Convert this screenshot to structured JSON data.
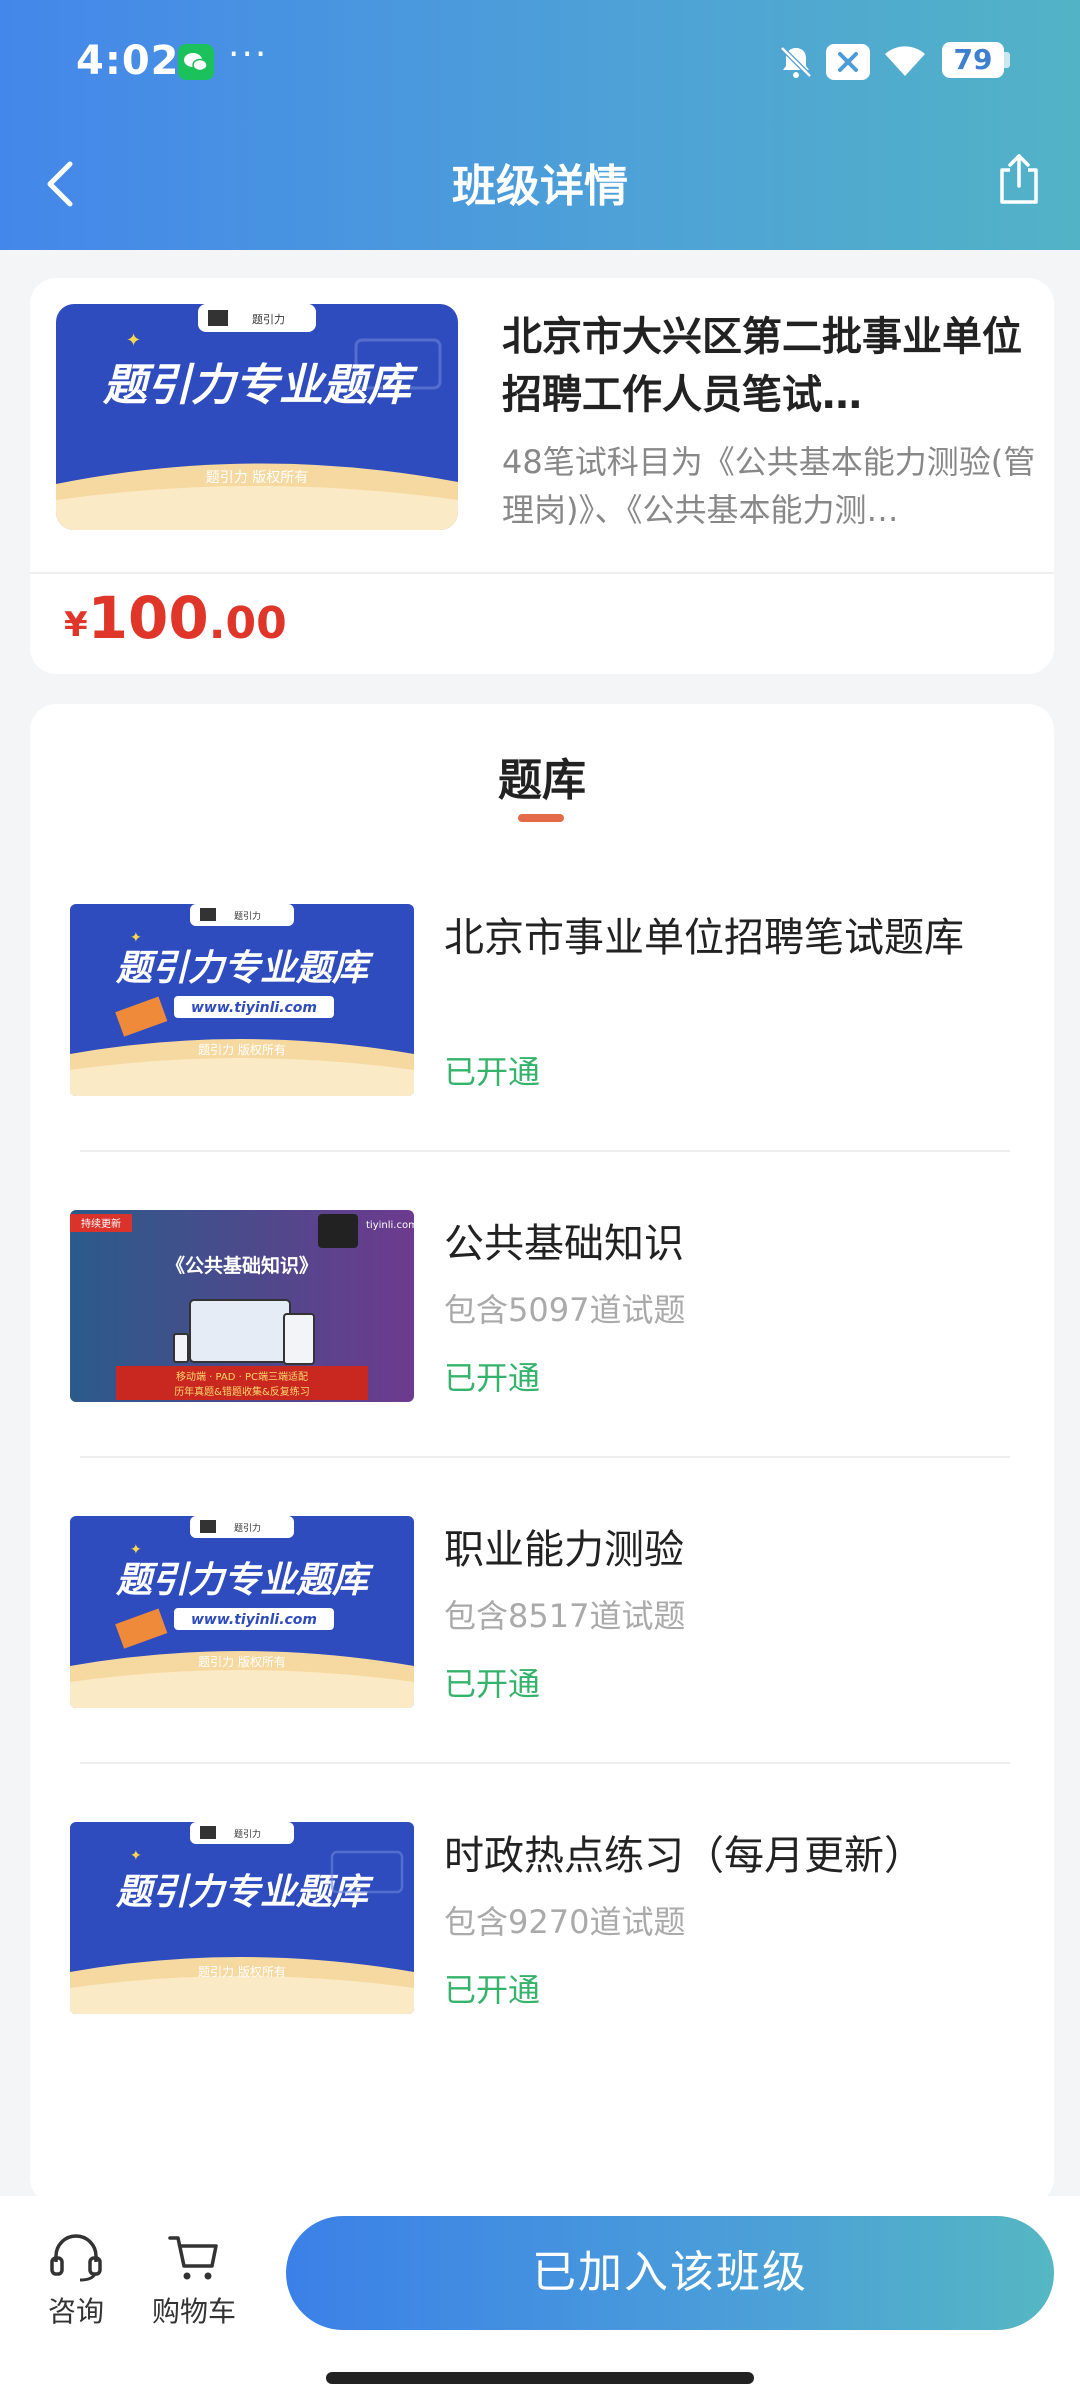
{
  "status_bar": {
    "time": "4:02",
    "more": "···",
    "battery": "79"
  },
  "header": {
    "title": "班级详情"
  },
  "class_info": {
    "thumb": {
      "brand": "题引力",
      "title": "题引力专业题库",
      "footer": "题引力 版权所有"
    },
    "title": "北京市大兴区第二批事业单位招聘工作人员笔试…",
    "description": "48笔试科目为《公共基本能力测验(管理岗)》、《公共基本能力测…",
    "price": {
      "currency": "¥",
      "integer": "100",
      "decimal": ".00"
    }
  },
  "question_bank": {
    "tab_label": "题库",
    "items": [
      {
        "name": "北京市事业单位招聘笔试题库",
        "count": "",
        "status": "已开通",
        "thumb": {
          "brand": "题引力",
          "title": "题引力专业题库",
          "url": "www.tiyinli.com",
          "footer": "题引力 版权所有"
        }
      },
      {
        "name": "公共基础知识",
        "count": "包含5097道试题",
        "status": "已开通",
        "thumb": {
          "tag": "持续更新",
          "title": "《公共基础知识》",
          "site": "tiyinli.com",
          "footer1": "移动端 · PAD · PC端三端适配",
          "footer2": "历年真题&错题收集&反复练习"
        }
      },
      {
        "name": "职业能力测验",
        "count": "包含8517道试题",
        "status": "已开通",
        "thumb": {
          "brand": "题引力",
          "title": "题引力专业题库",
          "url": "www.tiyinli.com",
          "footer": "题引力 版权所有"
        }
      },
      {
        "name": "时政热点练习（每月更新）",
        "count": "包含9270道试题",
        "status": "已开通",
        "thumb": {
          "brand": "题引力",
          "title": "题引力专业题库",
          "footer": "题引力 版权所有"
        }
      }
    ]
  },
  "bottom_bar": {
    "consult_label": "咨询",
    "cart_label": "购物车",
    "join_label": "已加入该班级"
  },
  "colors": {
    "accent": "#4487ea",
    "price": "#e0362a",
    "status": "#35b36b",
    "tab_underline": "#e46a4a"
  }
}
